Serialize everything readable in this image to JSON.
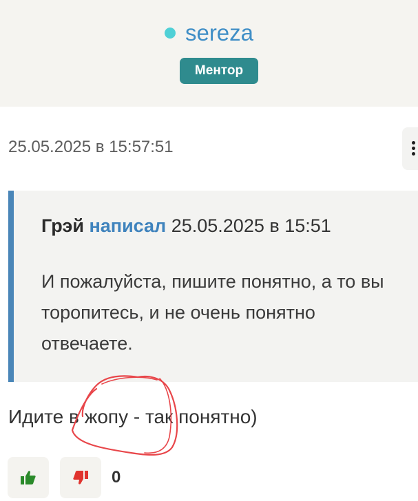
{
  "author": {
    "name": "sereza",
    "role_badge": "Ментор",
    "status_color": "#4fd0d6",
    "status_icon": "online-dot-icon"
  },
  "post": {
    "date": "25.05.2025 в 15:57:51",
    "menu_icon": "more-vertical-icon",
    "quote": {
      "author": "Грэй",
      "wrote_label": "написал",
      "date": "25.05.2025 в 15:51",
      "text": "И пожалуйста, пишите понятно, а то вы торопитесь, и не очень понятно отвечаете."
    },
    "reply_text": "Идите в жопу - так понятно)",
    "annotation": "red-circle-scribble",
    "votes": {
      "like_icon": "thumbs-up-icon",
      "dislike_icon": "thumbs-down-icon",
      "like_color": "#2a8a2a",
      "dislike_color": "#e0332e",
      "count": "0"
    }
  },
  "colors": {
    "header_bg": "#f5f4f0",
    "link_blue": "#3f8ec6",
    "badge_teal": "#2f8b8e",
    "quote_border": "#4a86b8",
    "scribble_red": "#e8464a"
  }
}
